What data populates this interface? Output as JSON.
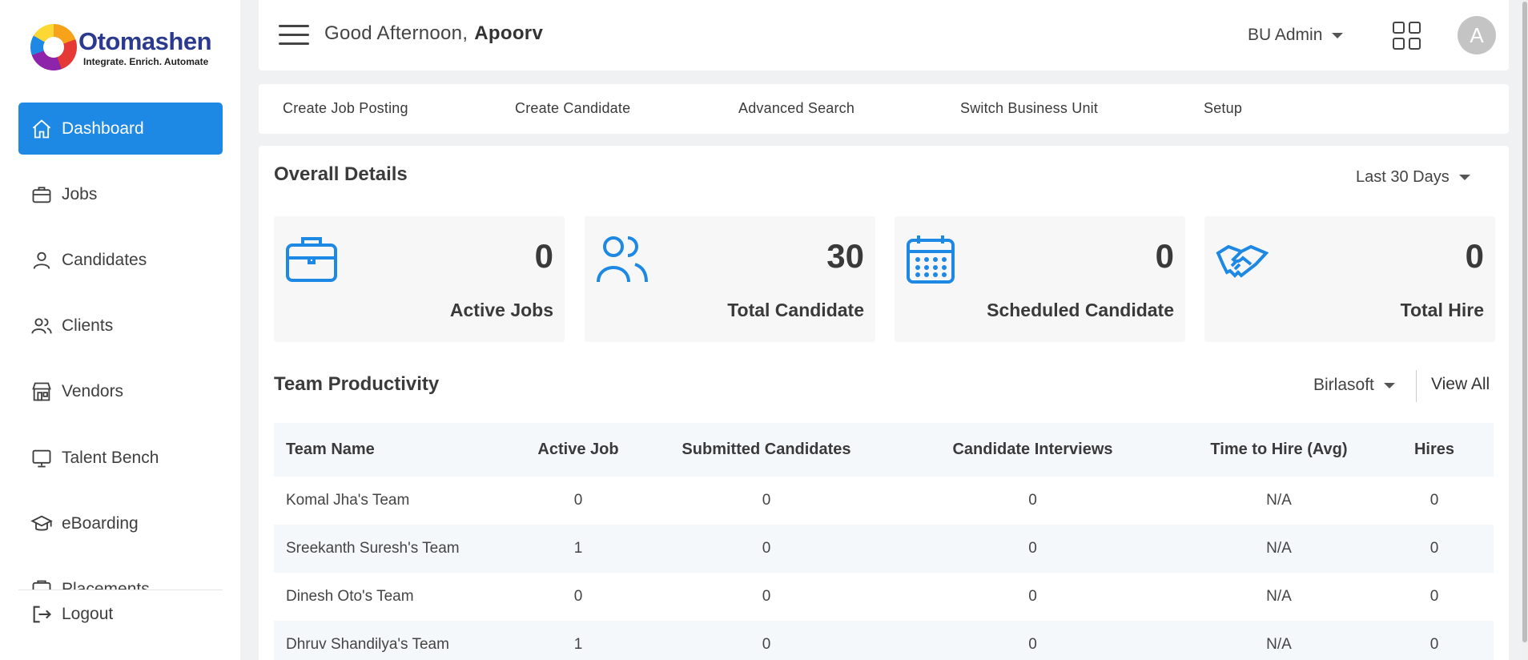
{
  "brand": {
    "name": "Otomashen",
    "tagline": "Integrate. Enrich. Automate"
  },
  "sidebar": {
    "items": [
      {
        "label": "Dashboard",
        "icon": "home-icon",
        "active": true
      },
      {
        "label": "Jobs",
        "icon": "briefcase-icon"
      },
      {
        "label": "Candidates",
        "icon": "user-icon"
      },
      {
        "label": "Clients",
        "icon": "users-icon"
      },
      {
        "label": "Vendors",
        "icon": "store-icon"
      },
      {
        "label": "Talent Bench",
        "icon": "monitor-icon"
      },
      {
        "label": "eBoarding",
        "icon": "graduation-cap-icon"
      },
      {
        "label": "Placements",
        "icon": "placement-icon"
      }
    ],
    "logout_label": "Logout"
  },
  "header": {
    "greeting": "Good Afternoon,",
    "user_name": "Apoorv",
    "role": "BU Admin",
    "avatar_initial": "A"
  },
  "quick_links": [
    "Create Job Posting",
    "Create Candidate",
    "Advanced Search",
    "Switch Business Unit",
    "Setup"
  ],
  "overall": {
    "title": "Overall Details",
    "range": "Last 30 Days",
    "stats": [
      {
        "value": "0",
        "label": "Active Jobs",
        "icon": "briefcase-icon"
      },
      {
        "value": "30",
        "label": "Total Candidate",
        "icon": "users-icon"
      },
      {
        "value": "0",
        "label": "Scheduled Candidate",
        "icon": "calendar-icon"
      },
      {
        "value": "0",
        "label": "Total Hire",
        "icon": "handshake-icon"
      }
    ]
  },
  "team": {
    "title": "Team Productivity",
    "filter": "Birlasoft",
    "view_all": "View All",
    "columns": [
      "Team Name",
      "Active Job",
      "Submitted Candidates",
      "Candidate Interviews",
      "Time to Hire (Avg)",
      "Hires"
    ],
    "rows": [
      [
        "Komal Jha's Team",
        "0",
        "0",
        "0",
        "N/A",
        "0"
      ],
      [
        "Sreekanth Suresh's Team",
        "1",
        "0",
        "0",
        "N/A",
        "0"
      ],
      [
        "Dinesh Oto's Team",
        "0",
        "0",
        "0",
        "N/A",
        "0"
      ],
      [
        "Dhruv Shandilya's Team",
        "1",
        "0",
        "0",
        "N/A",
        "0"
      ]
    ]
  },
  "colors": {
    "accent": "#1e88e5",
    "background": "#f0f1f3"
  }
}
